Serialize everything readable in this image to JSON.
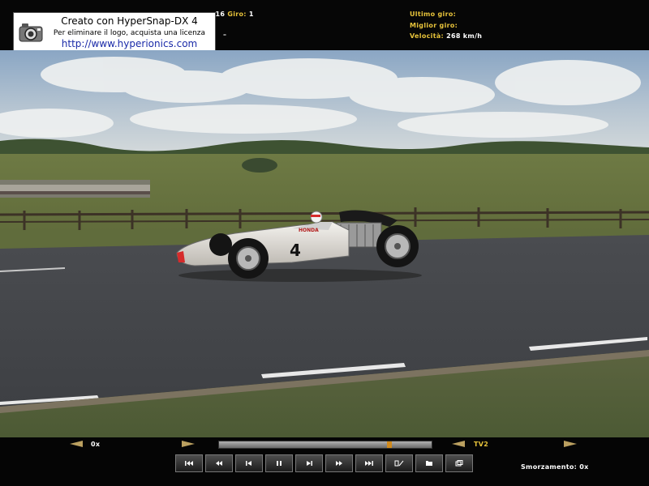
{
  "hud": {
    "lap_time_partial": ":16",
    "lap_label": "Giro:",
    "lap_value": "1",
    "last_lap_label": "Ultimo giro:",
    "best_lap_label": "Miglior giro:",
    "speed_label": "Velocità:",
    "speed_value": "268 km/h",
    "dash": "–",
    "colors": {
      "label": "#e6c23a",
      "value": "#ffffff"
    }
  },
  "watermark": {
    "line1": "Creato con HyperSnap-DX 4",
    "line2": "Per eliminare il logo, acquista una licenza",
    "line3": "http://www.hyperionics.com",
    "icon": "camera-icon"
  },
  "car": {
    "number": "4",
    "brand": "HONDA"
  },
  "replay": {
    "speed_left_value": "0x",
    "progress": 0.81,
    "camera_label": "TV2",
    "damping_label": "Smorzamento:",
    "damping_value": "0x",
    "buttons": [
      {
        "name": "skip-to-start-button",
        "icon": "skip-start-icon"
      },
      {
        "name": "rewind-button",
        "icon": "rewind-icon"
      },
      {
        "name": "step-back-button",
        "icon": "step-back-icon"
      },
      {
        "name": "pause-button",
        "icon": "pause-icon"
      },
      {
        "name": "step-forward-button",
        "icon": "step-forward-icon"
      },
      {
        "name": "fast-forward-button",
        "icon": "fast-forward-icon"
      },
      {
        "name": "skip-to-end-button",
        "icon": "skip-end-icon"
      },
      {
        "name": "mark-button",
        "icon": "mark-icon"
      },
      {
        "name": "folder-button",
        "icon": "folder-icon"
      },
      {
        "name": "window-button",
        "icon": "window-icon"
      }
    ]
  }
}
